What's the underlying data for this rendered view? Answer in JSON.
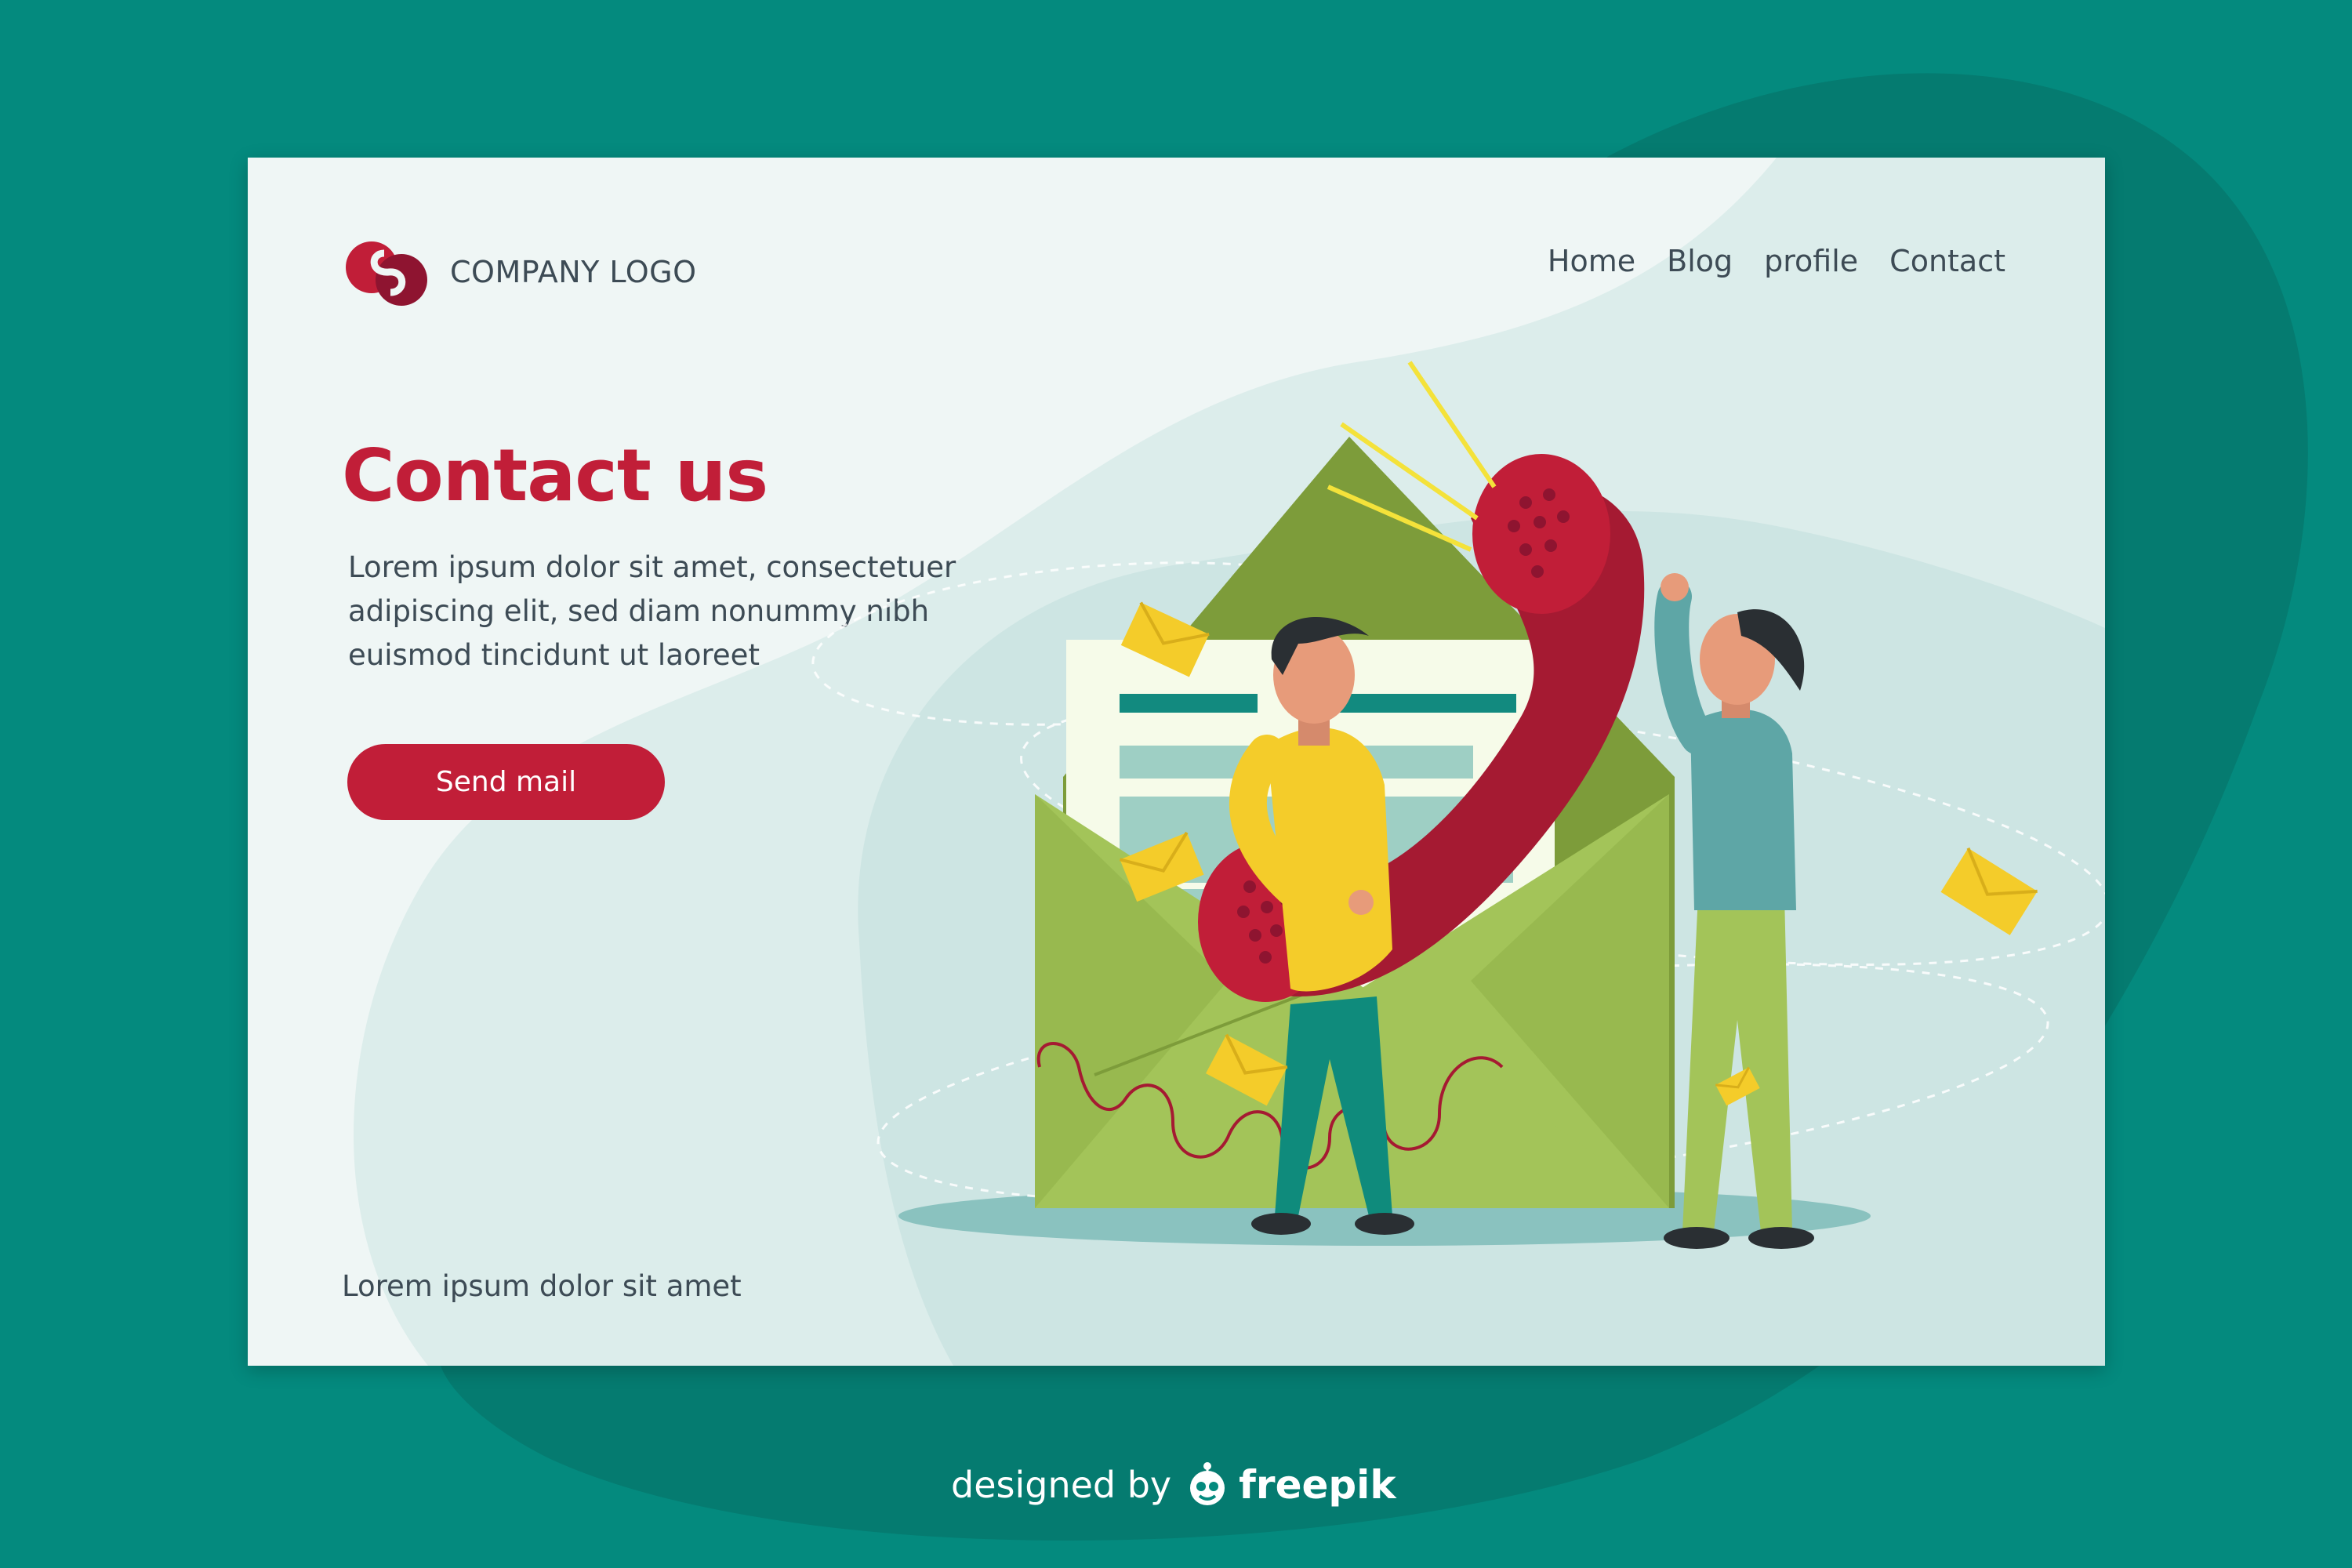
{
  "colors": {
    "page_background": "#048a7e",
    "card_background": "#eff6f5",
    "accent_red": "#c11e38",
    "text_dark": "#3d4b55"
  },
  "header": {
    "logo_icon": "company-logo-icon",
    "logo_text": "COMPANY LOGO",
    "nav": [
      "Home",
      "Blog",
      "profile",
      "Contact"
    ]
  },
  "hero": {
    "title": "Contact us",
    "body_lines": [
      "Lorem ipsum dolor sit amet, consectetuer",
      "adipiscing elit, sed diam nonummy nibh",
      "euismod tincidunt ut laoreet"
    ],
    "button_label": "Send mail"
  },
  "footer": {
    "text": "Lorem ipsum dolor sit amet"
  },
  "illustration": {
    "icon": "contact-illustration",
    "elements": [
      "open-envelope",
      "letter-form",
      "telephone-handset",
      "person-yellow-shirt",
      "person-teal-shirt",
      "small-envelopes"
    ]
  },
  "credit": {
    "prefix": "designed by",
    "brand": "freepik",
    "icon": "freepik-logo-icon"
  }
}
